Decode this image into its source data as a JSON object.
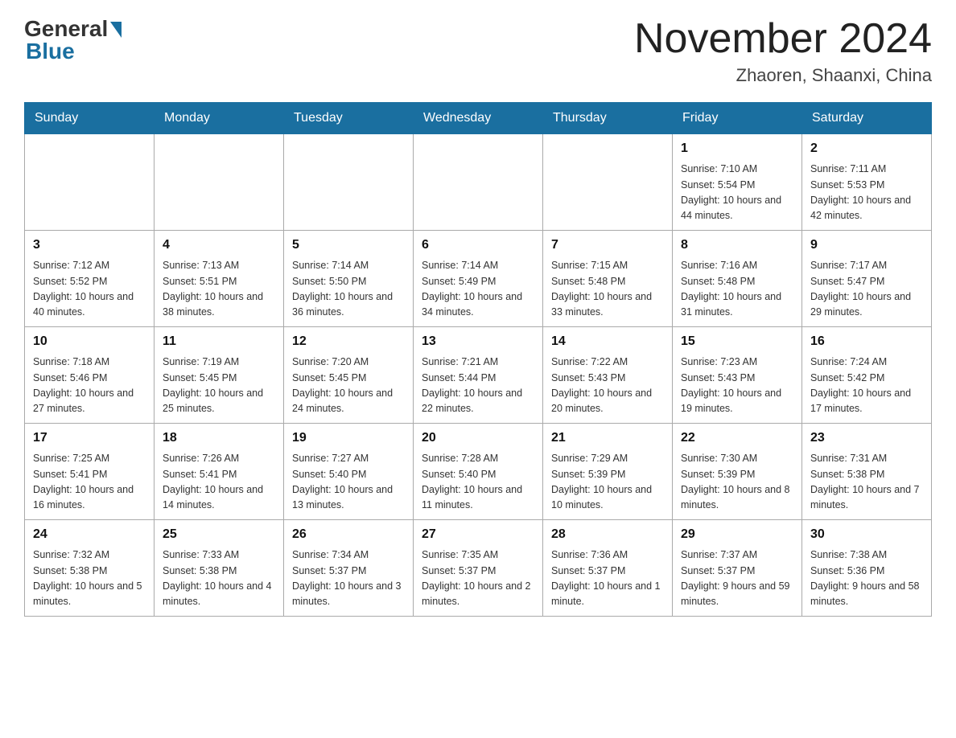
{
  "header": {
    "logo_general": "General",
    "logo_blue": "Blue",
    "title": "November 2024",
    "location": "Zhaoren, Shaanxi, China"
  },
  "weekdays": [
    "Sunday",
    "Monday",
    "Tuesday",
    "Wednesday",
    "Thursday",
    "Friday",
    "Saturday"
  ],
  "weeks": [
    [
      {
        "day": "",
        "info": ""
      },
      {
        "day": "",
        "info": ""
      },
      {
        "day": "",
        "info": ""
      },
      {
        "day": "",
        "info": ""
      },
      {
        "day": "",
        "info": ""
      },
      {
        "day": "1",
        "info": "Sunrise: 7:10 AM\nSunset: 5:54 PM\nDaylight: 10 hours and 44 minutes."
      },
      {
        "day": "2",
        "info": "Sunrise: 7:11 AM\nSunset: 5:53 PM\nDaylight: 10 hours and 42 minutes."
      }
    ],
    [
      {
        "day": "3",
        "info": "Sunrise: 7:12 AM\nSunset: 5:52 PM\nDaylight: 10 hours and 40 minutes."
      },
      {
        "day": "4",
        "info": "Sunrise: 7:13 AM\nSunset: 5:51 PM\nDaylight: 10 hours and 38 minutes."
      },
      {
        "day": "5",
        "info": "Sunrise: 7:14 AM\nSunset: 5:50 PM\nDaylight: 10 hours and 36 minutes."
      },
      {
        "day": "6",
        "info": "Sunrise: 7:14 AM\nSunset: 5:49 PM\nDaylight: 10 hours and 34 minutes."
      },
      {
        "day": "7",
        "info": "Sunrise: 7:15 AM\nSunset: 5:48 PM\nDaylight: 10 hours and 33 minutes."
      },
      {
        "day": "8",
        "info": "Sunrise: 7:16 AM\nSunset: 5:48 PM\nDaylight: 10 hours and 31 minutes."
      },
      {
        "day": "9",
        "info": "Sunrise: 7:17 AM\nSunset: 5:47 PM\nDaylight: 10 hours and 29 minutes."
      }
    ],
    [
      {
        "day": "10",
        "info": "Sunrise: 7:18 AM\nSunset: 5:46 PM\nDaylight: 10 hours and 27 minutes."
      },
      {
        "day": "11",
        "info": "Sunrise: 7:19 AM\nSunset: 5:45 PM\nDaylight: 10 hours and 25 minutes."
      },
      {
        "day": "12",
        "info": "Sunrise: 7:20 AM\nSunset: 5:45 PM\nDaylight: 10 hours and 24 minutes."
      },
      {
        "day": "13",
        "info": "Sunrise: 7:21 AM\nSunset: 5:44 PM\nDaylight: 10 hours and 22 minutes."
      },
      {
        "day": "14",
        "info": "Sunrise: 7:22 AM\nSunset: 5:43 PM\nDaylight: 10 hours and 20 minutes."
      },
      {
        "day": "15",
        "info": "Sunrise: 7:23 AM\nSunset: 5:43 PM\nDaylight: 10 hours and 19 minutes."
      },
      {
        "day": "16",
        "info": "Sunrise: 7:24 AM\nSunset: 5:42 PM\nDaylight: 10 hours and 17 minutes."
      }
    ],
    [
      {
        "day": "17",
        "info": "Sunrise: 7:25 AM\nSunset: 5:41 PM\nDaylight: 10 hours and 16 minutes."
      },
      {
        "day": "18",
        "info": "Sunrise: 7:26 AM\nSunset: 5:41 PM\nDaylight: 10 hours and 14 minutes."
      },
      {
        "day": "19",
        "info": "Sunrise: 7:27 AM\nSunset: 5:40 PM\nDaylight: 10 hours and 13 minutes."
      },
      {
        "day": "20",
        "info": "Sunrise: 7:28 AM\nSunset: 5:40 PM\nDaylight: 10 hours and 11 minutes."
      },
      {
        "day": "21",
        "info": "Sunrise: 7:29 AM\nSunset: 5:39 PM\nDaylight: 10 hours and 10 minutes."
      },
      {
        "day": "22",
        "info": "Sunrise: 7:30 AM\nSunset: 5:39 PM\nDaylight: 10 hours and 8 minutes."
      },
      {
        "day": "23",
        "info": "Sunrise: 7:31 AM\nSunset: 5:38 PM\nDaylight: 10 hours and 7 minutes."
      }
    ],
    [
      {
        "day": "24",
        "info": "Sunrise: 7:32 AM\nSunset: 5:38 PM\nDaylight: 10 hours and 5 minutes."
      },
      {
        "day": "25",
        "info": "Sunrise: 7:33 AM\nSunset: 5:38 PM\nDaylight: 10 hours and 4 minutes."
      },
      {
        "day": "26",
        "info": "Sunrise: 7:34 AM\nSunset: 5:37 PM\nDaylight: 10 hours and 3 minutes."
      },
      {
        "day": "27",
        "info": "Sunrise: 7:35 AM\nSunset: 5:37 PM\nDaylight: 10 hours and 2 minutes."
      },
      {
        "day": "28",
        "info": "Sunrise: 7:36 AM\nSunset: 5:37 PM\nDaylight: 10 hours and 1 minute."
      },
      {
        "day": "29",
        "info": "Sunrise: 7:37 AM\nSunset: 5:37 PM\nDaylight: 9 hours and 59 minutes."
      },
      {
        "day": "30",
        "info": "Sunrise: 7:38 AM\nSunset: 5:36 PM\nDaylight: 9 hours and 58 minutes."
      }
    ]
  ]
}
